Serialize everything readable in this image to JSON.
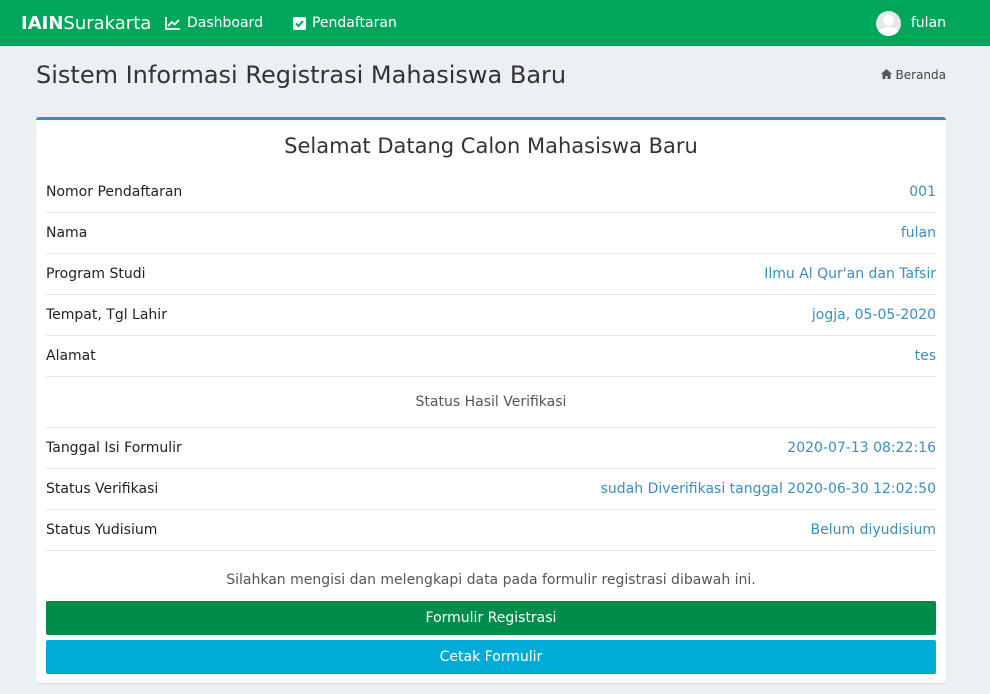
{
  "navbar": {
    "brand_bold": "IAIN",
    "brand_rest": "Surakarta",
    "items": [
      {
        "label": "Dashboard",
        "icon": "line-chart-icon"
      },
      {
        "label": "Pendaftaran",
        "icon": "check-square-icon"
      }
    ],
    "user_name": "fulan",
    "color": "#00a65a"
  },
  "header": {
    "title": "Sistem Informasi Registrasi Mahasiswa Baru",
    "breadcrumb": "Beranda"
  },
  "box": {
    "title": "Selamat Datang Calon Mahasiswa Baru",
    "rows": [
      {
        "label": "Nomor Pendaftaran",
        "value": "001"
      },
      {
        "label": "Nama",
        "value": "fulan"
      },
      {
        "label": "Program Studi",
        "value": "Ilmu Al Qur'an dan Tafsir"
      },
      {
        "label": "Tempat, Tgl Lahir",
        "value": "jogja, 05-05-2020"
      },
      {
        "label": "Alamat",
        "value": "tes"
      }
    ],
    "section_label": "Status Hasil Verifikasi",
    "status_rows": [
      {
        "label": "Tanggal Isi Formulir",
        "value": "2020-07-13 08:22:16"
      },
      {
        "label": "Status Verifikasi",
        "value": "sudah Diverifikasi tanggal 2020-06-30 12:02:50"
      },
      {
        "label": "Status Yudisium",
        "value": "Belum diyudisium"
      }
    ],
    "note": "Silahkan mengisi dan melengkapi data pada formulir registrasi dibawah ini.",
    "btn_form": "Formulir Registrasi",
    "btn_print": "Cetak Formulir"
  }
}
